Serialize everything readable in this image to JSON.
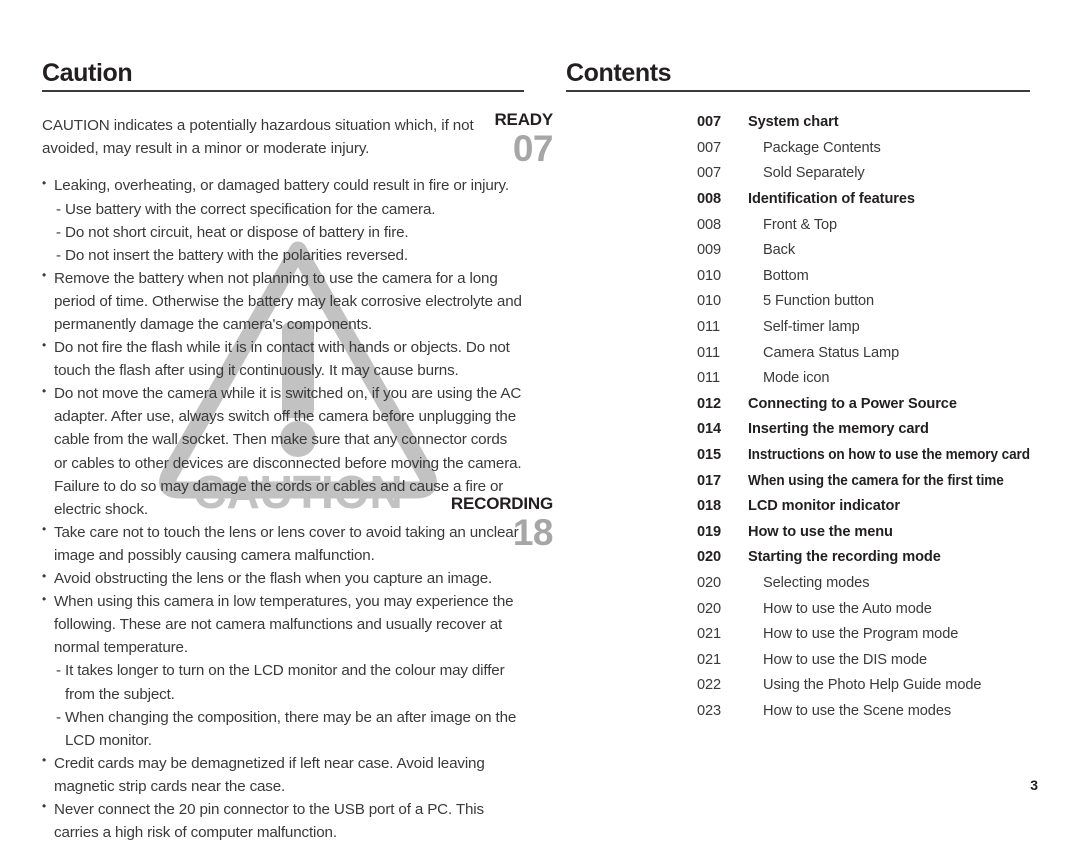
{
  "left": {
    "heading": "Caution",
    "intro": "CAUTION indicates a potentially hazardous situation which, if not avoided, may result in a minor or moderate injury.",
    "items": [
      {
        "type": "bullet",
        "text": "Leaking, overheating, or damaged battery could result in fire or injury."
      },
      {
        "type": "dash",
        "text": "Use battery with the correct specification for the camera."
      },
      {
        "type": "dash",
        "text": "Do not short circuit, heat or dispose of battery in fire."
      },
      {
        "type": "dash",
        "text": "Do not insert the battery with the polarities reversed."
      },
      {
        "type": "bullet",
        "text": "Remove the battery when not planning to use the camera for a long period of time. Otherwise the battery may leak corrosive electrolyte and permanently damage the camera's components."
      },
      {
        "type": "bullet",
        "text": "Do not fire the flash while it is in contact with hands or objects. Do not touch the flash after using it continuously. It may cause burns."
      },
      {
        "type": "bullet",
        "text": "Do not move the camera while it is switched on, if you are using the AC adapter. After use, always switch off the camera before unplugging the cable from the wall socket. Then make sure that any connector cords or cables to other devices are disconnected before moving the camera. Failure to do so may damage the cords or cables and cause a fire or electric shock."
      },
      {
        "type": "bullet",
        "text": "Take care not to touch the lens or lens cover to avoid taking an unclear image and possibly causing camera malfunction."
      },
      {
        "type": "bullet",
        "text": "Avoid obstructing the lens or the flash when you capture an image."
      },
      {
        "type": "bullet",
        "text": "When using this camera in low temperatures, you may experience the following. These are not camera malfunctions and usually recover at normal temperature."
      },
      {
        "type": "dash",
        "text": "It takes longer to turn on the LCD monitor and the colour may differ from the subject."
      },
      {
        "type": "dash",
        "text": "When changing the composition, there may be an after image on the LCD monitor."
      },
      {
        "type": "bullet",
        "text": "Credit cards may be demagnetized if left near case. Avoid leaving magnetic strip cards near the case."
      },
      {
        "type": "bullet",
        "text": "Never connect the 20 pin connector to the USB port of a PC. This carries a high risk of computer malfunction."
      }
    ],
    "watermark": {
      "label": "CAUTION",
      "symbol": "exclamation-mark",
      "color": "#bfbfbf"
    }
  },
  "right": {
    "heading": "Contents",
    "groups": [
      {
        "tag_label": "READY",
        "tag_number": "07",
        "rows": [
          {
            "num": "007",
            "title": "System chart",
            "level": 1
          },
          {
            "num": "007",
            "title": "Package Contents",
            "level": 2
          },
          {
            "num": "007",
            "title": "Sold Separately",
            "level": 2
          },
          {
            "num": "008",
            "title": "Identification of features",
            "level": 1
          },
          {
            "num": "008",
            "title": "Front & Top",
            "level": 2
          },
          {
            "num": "009",
            "title": "Back",
            "level": 2
          },
          {
            "num": "010",
            "title": "Bottom",
            "level": 2
          },
          {
            "num": "010",
            "title": "5 Function button",
            "level": 2
          },
          {
            "num": "011",
            "title": "Self-timer lamp",
            "level": 2
          },
          {
            "num": "011",
            "title": "Camera Status Lamp",
            "level": 2
          },
          {
            "num": "011",
            "title": "Mode icon",
            "level": 2
          },
          {
            "num": "012",
            "title": "Connecting to a Power Source",
            "level": 1
          },
          {
            "num": "014",
            "title": "Inserting the memory card",
            "level": 1
          },
          {
            "num": "015",
            "title": "Instructions on how to use the memory card",
            "level": 1,
            "narrow": true
          },
          {
            "num": "017",
            "title": "When using the camera for the first time",
            "level": 1,
            "narrow": true
          }
        ]
      },
      {
        "tag_label": "RECORDING",
        "tag_number": "18",
        "rows": [
          {
            "num": "018",
            "title": "LCD monitor indicator",
            "level": 1
          },
          {
            "num": "019",
            "title": "How to use the menu",
            "level": 1
          },
          {
            "num": "020",
            "title": "Starting the recording mode",
            "level": 1
          },
          {
            "num": "020",
            "title": "Selecting modes",
            "level": 2
          },
          {
            "num": "020",
            "title": "How to use the Auto mode",
            "level": 2
          },
          {
            "num": "021",
            "title": "How to use the Program mode",
            "level": 2
          },
          {
            "num": "021",
            "title": "How to use the DIS mode",
            "level": 2
          },
          {
            "num": "022",
            "title": "Using the Photo Help Guide mode",
            "level": 2
          },
          {
            "num": "023",
            "title": "How to use the Scene modes",
            "level": 2
          }
        ]
      }
    ]
  },
  "footer": {
    "page_number": "3"
  }
}
